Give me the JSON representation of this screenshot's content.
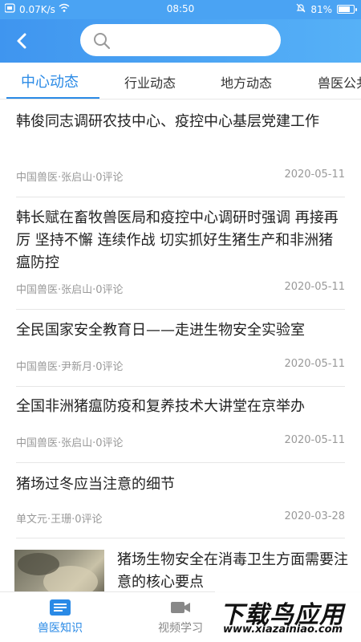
{
  "status_bar": {
    "speed": "0.07K/s",
    "time": "08:50",
    "battery": "81%",
    "battery_level": 0.81
  },
  "header": {
    "search_placeholder": ""
  },
  "tabs": [
    "中心动态",
    "行业动态",
    "地方动态",
    "兽医公共"
  ],
  "articles": [
    {
      "title": "韩俊同志调研农技中心、疫控中心基层党建工作",
      "meta": "中国兽医·张启山·0评论",
      "date": "2020-05-11"
    },
    {
      "title": "韩长赋在畜牧兽医局和疫控中心调研时强调 再接再厉 坚持不懈 连续作战 切实抓好生猪生产和非洲猪瘟防控",
      "meta": "中国兽医·张启山·0评论",
      "date": "2020-05-11"
    },
    {
      "title": "全民国家安全教育日——走进生物安全实验室",
      "meta": "中国兽医·尹新月·0评论",
      "date": "2020-05-11"
    },
    {
      "title": "全国非洲猪瘟防疫和复养技术大讲堂在京举办",
      "meta": "中国兽医·张启山·0评论",
      "date": "2020-05-11"
    },
    {
      "title": "猪场过冬应当注意的细节",
      "meta": "单文元·王珊·0评论",
      "date": "2020-03-28"
    }
  ],
  "featured": {
    "title": "猪场生物安全在消毒卫生方面需要注意的核心要点"
  },
  "bottom_nav": [
    "兽医知识",
    "视频学习"
  ],
  "watermark": {
    "main": "下载鸟应用",
    "url": "www.xiazainiao.com"
  },
  "colors": {
    "accent": "#2a8ae6",
    "header_start": "#3f95ef",
    "header_end": "#56b1f7"
  }
}
